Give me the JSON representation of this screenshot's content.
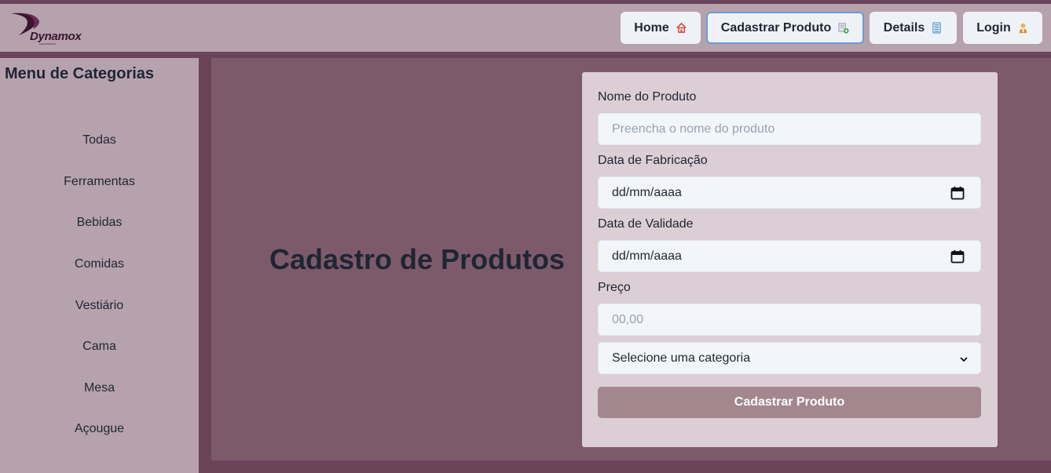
{
  "app": {
    "logo_text": "Dynamox",
    "logo_subtext": "ELECTRONICS"
  },
  "nav": {
    "home_label": "Home",
    "cadastrar_label": "Cadastrar Produto",
    "details_label": "Details",
    "login_label": "Login"
  },
  "sidebar": {
    "title": "Menu de Categorias",
    "items": [
      {
        "label": "Todas"
      },
      {
        "label": "Ferramentas"
      },
      {
        "label": "Bebidas"
      },
      {
        "label": "Comidas"
      },
      {
        "label": "Vestiário"
      },
      {
        "label": "Cama"
      },
      {
        "label": "Mesa"
      },
      {
        "label": "Açougue"
      }
    ]
  },
  "main": {
    "heading": "Cadastro de Produtos"
  },
  "form": {
    "name_label": "Nome do Produto",
    "name_placeholder": "Preencha o nome do produto",
    "manufacture_label": "Data de Fabricação",
    "manufacture_value": "dd/mm/aaaa",
    "expiry_label": "Data de Validade",
    "expiry_value": "dd/mm/aaaa",
    "price_label": "Preço",
    "price_placeholder": "00,00",
    "category_value": "Selecione uma categoria",
    "submit_label": "Cadastrar Produto"
  },
  "colors": {
    "background": "#6b4459",
    "topbar": "#b6a2ad",
    "main_panel": "#7d5a6a",
    "form_card": "#dbced4",
    "submit": "#a2878f",
    "active_border": "#6a9ad8"
  }
}
